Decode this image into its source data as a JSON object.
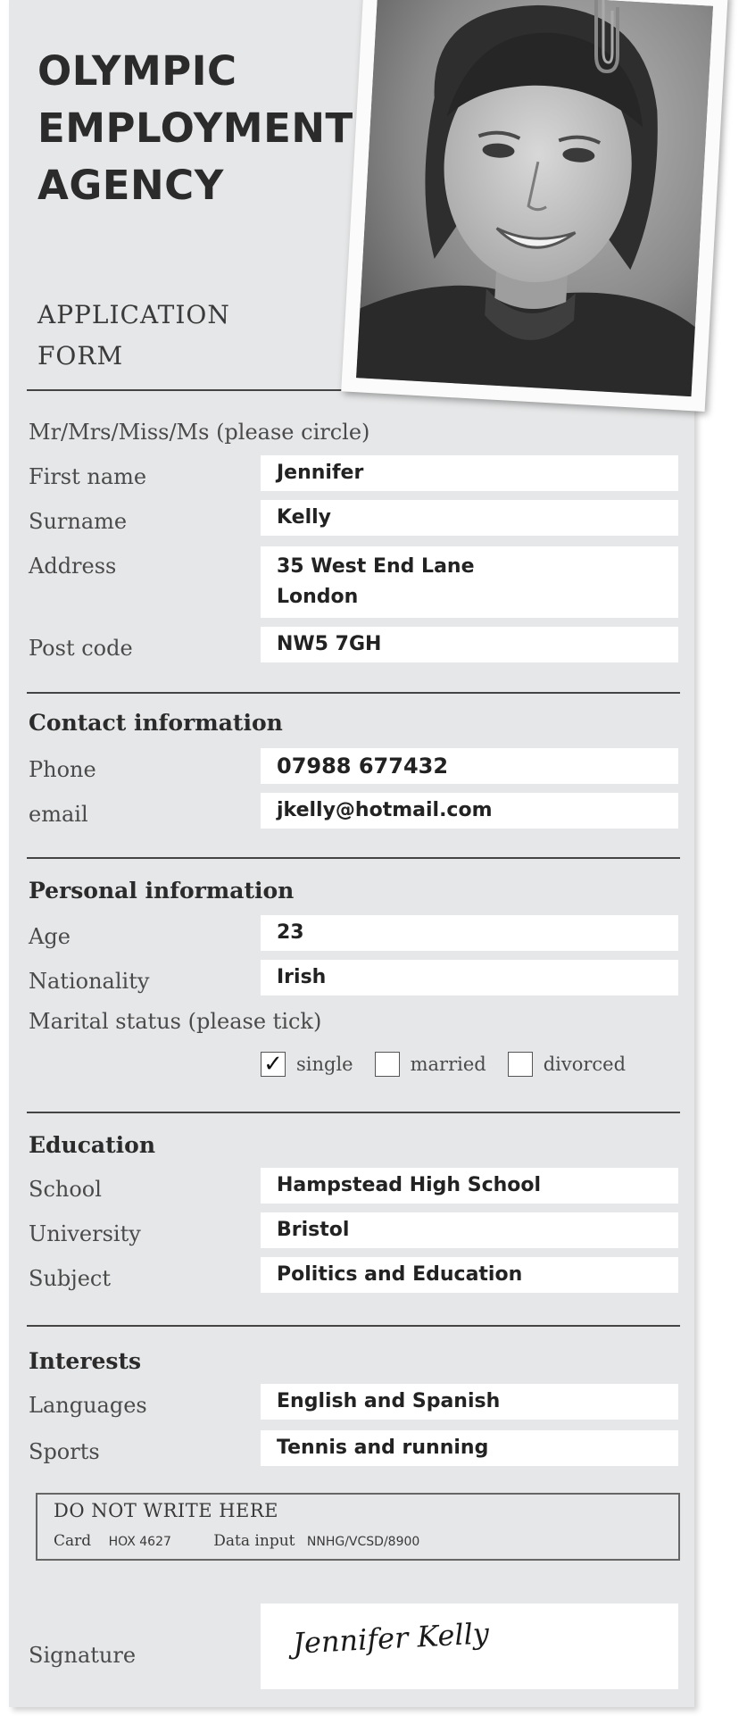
{
  "header": {
    "agency_line1": "OLYMPIC",
    "agency_line2": "EMPLOYMENT",
    "agency_line3": "AGENCY",
    "form_line1": "APPLICATION",
    "form_line2": "FORM"
  },
  "title_prompt": "Mr/Mrs/Miss/Ms  (please circle)",
  "personal": {
    "first_name_label": "First name",
    "first_name": "Jennifer",
    "surname_label": "Surname",
    "surname": "Kelly",
    "address_label": "Address",
    "address": "35 West End Lane\nLondon",
    "postcode_label": "Post code",
    "postcode": "NW5 7GH"
  },
  "contact": {
    "heading": "Contact information",
    "phone_label": "Phone",
    "phone": "07988 677432",
    "email_label": "email",
    "email": "jkelly@hotmail.com"
  },
  "personal_info": {
    "heading": "Personal information",
    "age_label": "Age",
    "age": "23",
    "nationality_label": "Nationality",
    "nationality": "Irish",
    "marital_label": "Marital status  (please tick)",
    "options": [
      {
        "label": "single",
        "checked": true
      },
      {
        "label": "married",
        "checked": false
      },
      {
        "label": "divorced",
        "checked": false
      }
    ],
    "check_mark": "✓"
  },
  "education": {
    "heading": "Education",
    "school_label": "School",
    "school": "Hampstead High School",
    "university_label": "University",
    "university": "Bristol",
    "subject_label": "Subject",
    "subject": "Politics and Education"
  },
  "interests": {
    "heading": "Interests",
    "languages_label": "Languages",
    "languages": "English and Spanish",
    "sports_label": "Sports",
    "sports": "Tennis and running"
  },
  "office_use": {
    "title": "DO NOT WRITE HERE",
    "card_label": "Card",
    "card_value": "HOX 4627",
    "data_label": "Data input",
    "data_value": "NNHG/VCSD/8900"
  },
  "signature": {
    "label": "Signature",
    "value": "Jennifer Kelly"
  },
  "colors": {
    "card_background": "#e6e7e8",
    "field_background": "#ffffff",
    "text": "#4a4a4a",
    "rule": "#444444"
  },
  "icons": {
    "photo": "applicant-photo",
    "clip": "paperclip-icon"
  }
}
